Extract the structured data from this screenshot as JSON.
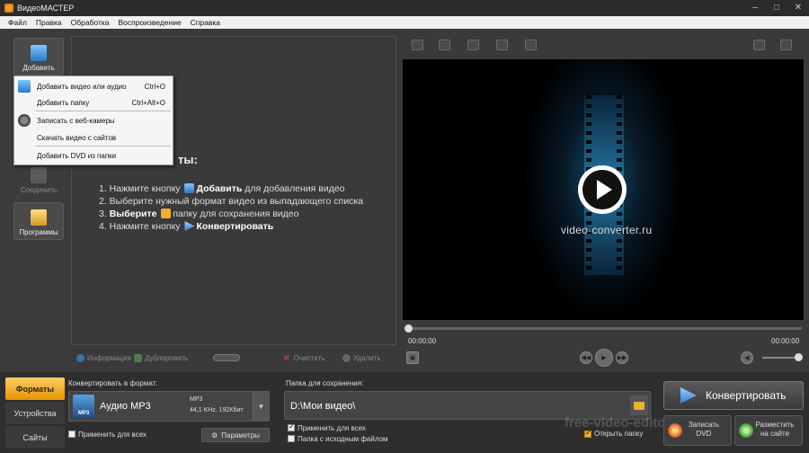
{
  "window": {
    "title": "ВидеоМАСТЕР",
    "minimize": "–",
    "maximize": "□",
    "close": "✕"
  },
  "menu": [
    "Файл",
    "Правка",
    "Обработка",
    "Воспроизведение",
    "Справка"
  ],
  "left_toolbar": {
    "add": "Добавить",
    "join": "Соединить",
    "programs": "Программы"
  },
  "dropdown": [
    {
      "label": "Добавить видео или аудио",
      "shortcut": "Ctrl+O"
    },
    {
      "label": "Добавить папку",
      "shortcut": "Ctrl+Alt+O"
    },
    {
      "label": "Записать с веб-камеры",
      "shortcut": ""
    },
    {
      "label": "Скачать видео с сайтов",
      "shortcut": ""
    },
    {
      "label": "Добавить DVD из папки",
      "shortcut": ""
    }
  ],
  "instructions": {
    "title_tail": "ты:",
    "step1_pre": "1. Нажмите кнопку",
    "step1_bold": "Добавить",
    "step1_post": "для добавления видео",
    "step2": "2. Выберите нужный формат видео из выпадающего списка",
    "step3_pre": "3.",
    "step3_bold": "Выберите",
    "step3_post": "папку для сохранения видео",
    "step4_pre": "4. Нажмите кнопку",
    "step4_bold": "Конвертировать"
  },
  "list_toolbar": {
    "info": "Информация",
    "duplicate": "Дублировать",
    "clear": "Очистить",
    "delete": "Удалить"
  },
  "player": {
    "site": "video-converter.ru",
    "time_start": "00:00:00",
    "time_end": "00:00:00",
    "progress": 0
  },
  "bottom_tabs": [
    "Форматы",
    "Устройства",
    "Сайты"
  ],
  "format": {
    "label": "Конвертировать в формат:",
    "icon_text": "MP3",
    "name": "Аудио MP3",
    "meta1": "MP3",
    "meta2": "44,1 KHz, 192Кбит",
    "apply_all": "Применить для всех",
    "params": "Параметры"
  },
  "folder": {
    "label": "Папка для сохранения:",
    "path": "D:\\Мои видео\\",
    "apply_all": "Применить для всех",
    "source_folder": "Папка с исходным файлом",
    "open": "Открыть папку"
  },
  "actions": {
    "convert": "Конвертировать",
    "burn_l1": "Записать",
    "burn_l2": "DVD",
    "publish_l1": "Разместить",
    "publish_l2": "на сайте"
  },
  "watermark": "free-video-editor",
  "colors": {
    "accent": "#f0a020",
    "convert_blue": "#2d7fd0"
  }
}
